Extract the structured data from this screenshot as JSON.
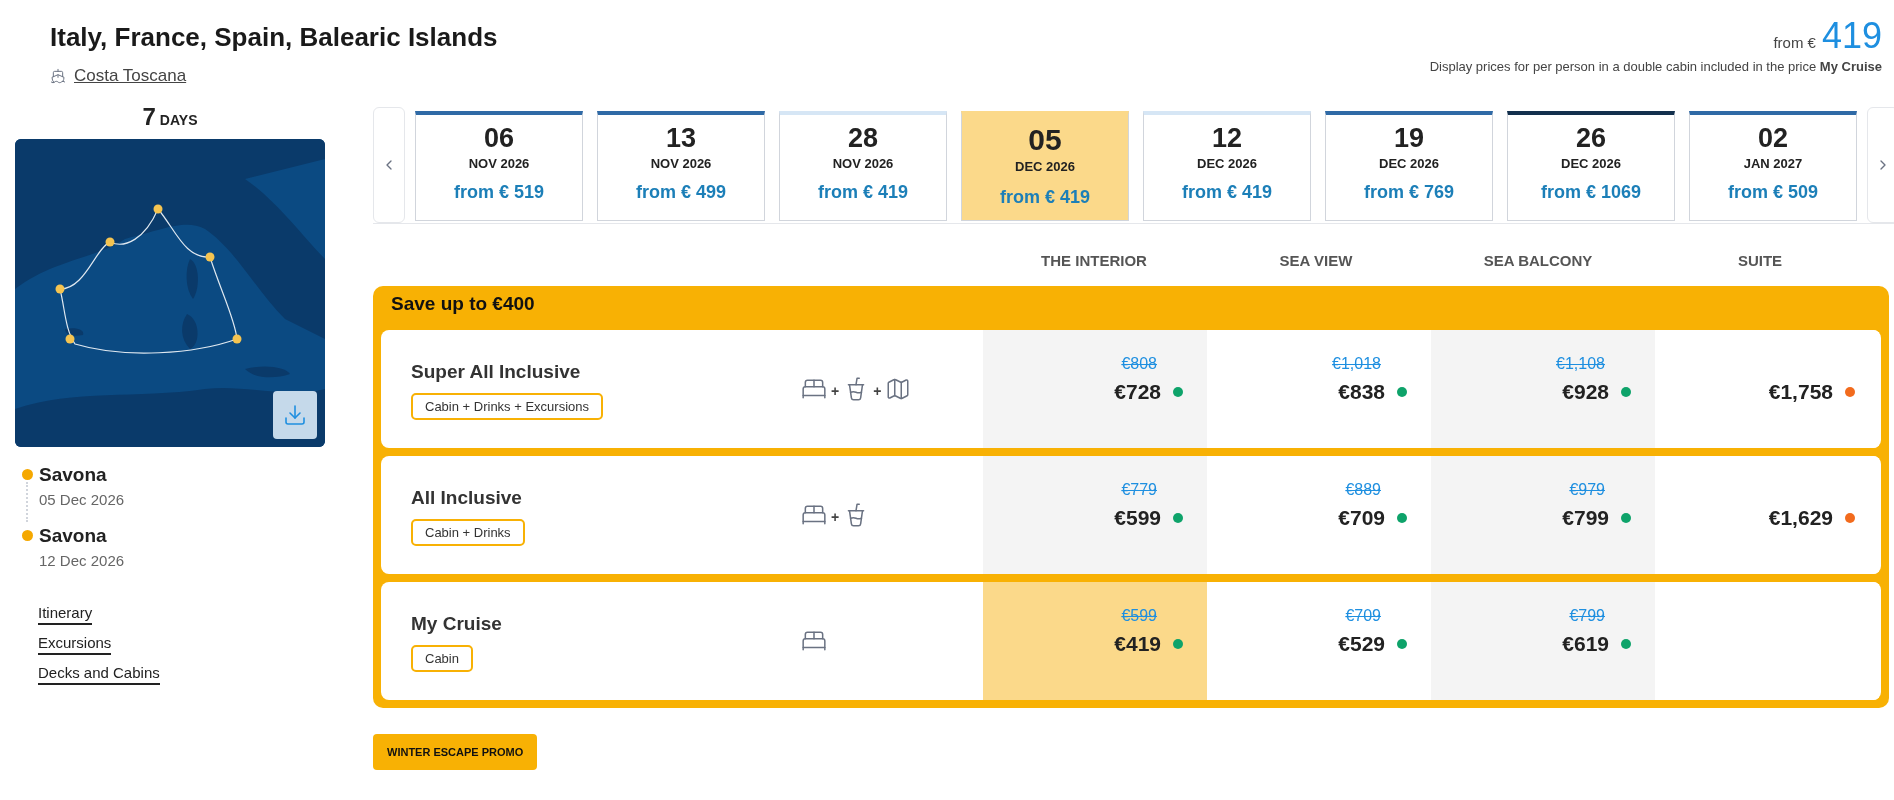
{
  "header": {
    "title": "Italy, France, Spain, Balearic Islands",
    "ship": "Costa Toscana",
    "from_label": "from €",
    "from_price": "419",
    "note": "Display prices for per person in a double cabin included in the price **My Cruise**"
  },
  "duration": {
    "number": "7",
    "unit": "DAYS"
  },
  "map": {
    "kind": "picture"
  },
  "stops": [
    {
      "port": "Savona",
      "date": "05 Dec 2026"
    },
    {
      "port": "Savona",
      "date": "12 Dec 2026"
    }
  ],
  "links": [
    "Itinerary",
    "Excursions",
    "Decks and Cabins"
  ],
  "dates": [
    {
      "day": "06",
      "month": "NOV 2026",
      "price": "from € 519",
      "selected": false,
      "color": "#2f6aa6"
    },
    {
      "day": "13",
      "month": "NOV 2026",
      "price": "from € 499",
      "selected": false,
      "color": "#2f6aa6"
    },
    {
      "day": "28",
      "month": "NOV 2026",
      "price": "from € 419",
      "selected": false,
      "color": "#d6e6f5"
    },
    {
      "day": "05",
      "month": "DEC 2026",
      "price": "from € 419",
      "selected": true,
      "color": "#fbd98a"
    },
    {
      "day": "12",
      "month": "DEC 2026",
      "price": "from € 419",
      "selected": false,
      "color": "#d6e6f5"
    },
    {
      "day": "19",
      "month": "DEC 2026",
      "price": "from € 769",
      "selected": false,
      "color": "#2f6aa6"
    },
    {
      "day": "26",
      "month": "DEC 2026",
      "price": "from € 1069",
      "selected": false,
      "color": "#13304d"
    },
    {
      "day": "02",
      "month": "JAN 2027",
      "price": "from € 509",
      "selected": false,
      "color": "#2f6aa6"
    }
  ],
  "columns": [
    "THE INTERIOR",
    "SEA VIEW",
    "SEA BALCONY",
    "SUITE"
  ],
  "offer_banner": "Save up to €400",
  "packages": [
    {
      "name": "Super All Inclusive",
      "tag": "Cabin + Drinks + Excursions",
      "icons": [
        {
          "kind": "bed"
        },
        {
          "kind": "drink",
          "joiner": "+"
        },
        {
          "kind": "map",
          "joiner": "+"
        }
      ],
      "cells": [
        {
          "was": "€808",
          "price": "€728",
          "color": "#0ea36a",
          "selected": false
        },
        {
          "was": "€1,018",
          "price": "€838",
          "color": "#0ea36a",
          "selected": false
        },
        {
          "was": "€1,108",
          "price": "€928",
          "color": "#0ea36a",
          "selected": false
        },
        {
          "price": "€1,758",
          "color": "#f26b1d",
          "selected": false
        }
      ]
    },
    {
      "name": "All Inclusive",
      "tag": "Cabin + Drinks",
      "icons": [
        {
          "kind": "bed"
        },
        {
          "kind": "drink",
          "joiner": "+"
        }
      ],
      "cells": [
        {
          "was": "€779",
          "price": "€599",
          "color": "#0ea36a",
          "selected": false
        },
        {
          "was": "€889",
          "price": "€709",
          "color": "#0ea36a",
          "selected": false
        },
        {
          "was": "€979",
          "price": "€799",
          "color": "#0ea36a",
          "selected": false
        },
        {
          "price": "€1,629",
          "color": "#f26b1d",
          "selected": false
        }
      ]
    },
    {
      "name": "My Cruise",
      "tag": "Cabin",
      "icons": [
        {
          "kind": "bed"
        }
      ],
      "cells": [
        {
          "was": "€599",
          "price": "€419",
          "color": "#0ea36a",
          "selected": true
        },
        {
          "was": "€709",
          "price": "€529",
          "color": "#0ea36a",
          "selected": false
        },
        {
          "was": "€799",
          "price": "€619",
          "color": "#0ea36a",
          "selected": false
        },
        {}
      ]
    }
  ],
  "promo_button": "WINTER ESCAPE PROMO"
}
